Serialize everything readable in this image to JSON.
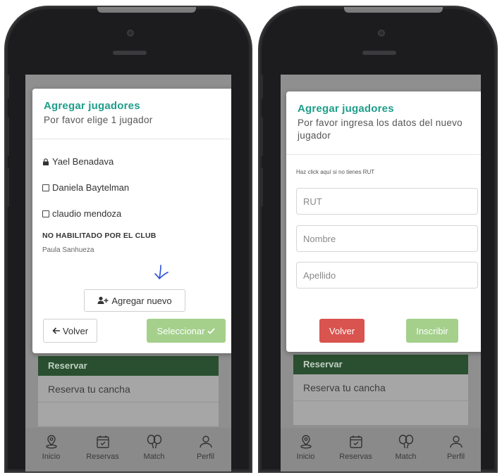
{
  "left_screen": {
    "modal": {
      "title": "Agregar jugadores",
      "subtitle": "Por favor elige 1 jugador",
      "players": [
        {
          "name": "Yael Benadava",
          "icon": "lock-icon"
        },
        {
          "name": "Daniela Baytelman",
          "icon": "checkbox-icon"
        },
        {
          "name": "claudio mendoza",
          "icon": "checkbox-icon"
        }
      ],
      "disabled_section_label": "NO HABILITADO POR EL CLUB",
      "disabled_players": [
        "Paula Sanhueza"
      ],
      "add_new_label": "Agregar nuevo",
      "back_label": "Volver",
      "select_label": "Seleccionar"
    }
  },
  "right_screen": {
    "modal": {
      "title": "Agregar jugadores",
      "subtitle": "Por favor ingresa los datos del nuevo jugador",
      "no_rut_note": "Haz click aquí si no tienes RUT",
      "fields": {
        "rut_placeholder": "RUT",
        "nombre_placeholder": "Nombre",
        "apellido_placeholder": "Apellido"
      },
      "back_label": "Volver",
      "submit_label": "Inscribir"
    }
  },
  "background": {
    "section_header": "Reservar",
    "row_label": "Reserva tu cancha"
  },
  "tabbar": {
    "items": [
      {
        "label": "Inicio",
        "icon": "location-icon"
      },
      {
        "label": "Reservas",
        "icon": "calendar-check-icon"
      },
      {
        "label": "Match",
        "icon": "tennis-rackets-icon"
      },
      {
        "label": "Perfil",
        "icon": "user-icon"
      }
    ]
  },
  "colors": {
    "title_teal": "#1e9e8a",
    "green_button": "#a4d08c",
    "red_button": "#d9534f",
    "section_header_green": "#2a4f30"
  }
}
